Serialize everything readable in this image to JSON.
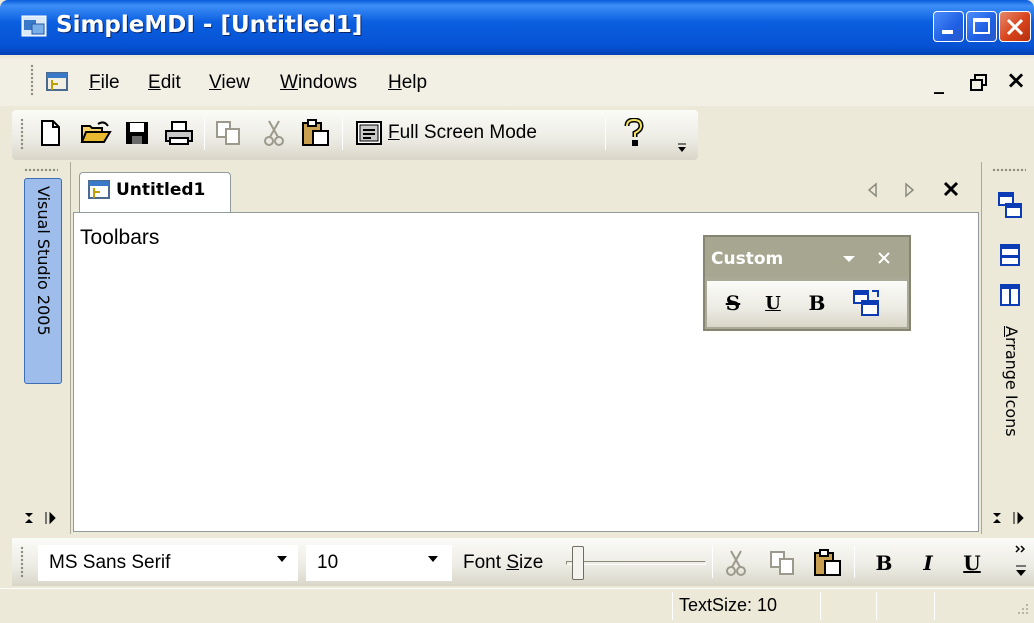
{
  "window": {
    "title": "SimpleMDI - [Untitled1]"
  },
  "menubar": {
    "items": [
      {
        "label": "File",
        "mnemonic": "F",
        "rest": "ile"
      },
      {
        "label": "Edit",
        "mnemonic": "E",
        "rest": "dit"
      },
      {
        "label": "View",
        "mnemonic": "V",
        "rest": "iew"
      },
      {
        "label": "Windows",
        "mnemonic": "W",
        "rest": "indows"
      },
      {
        "label": "Help",
        "mnemonic": "H",
        "rest": "elp"
      }
    ],
    "mdi_minimize": "_",
    "mdi_restore": "🗗",
    "mdi_close": "×"
  },
  "toolbar": {
    "buttons": [
      "new-icon",
      "open-icon",
      "save-icon",
      "print-icon",
      "copy-icon",
      "cut-icon",
      "paste-icon",
      "full-screen-icon",
      "help-icon"
    ],
    "fullscreen": {
      "mnemonic": "F",
      "rest": "ull Screen Mode"
    }
  },
  "left_dock": {
    "tab_label": "Visual Studio 2005"
  },
  "document": {
    "tab_label": "Untitled1",
    "text": "Toolbars"
  },
  "custom_toolbar": {
    "title": "Custom",
    "buttons": [
      {
        "name": "strikethrough-button",
        "glyph": "S"
      },
      {
        "name": "underline-button",
        "glyph": "U"
      },
      {
        "name": "bold-button",
        "glyph": "B"
      },
      {
        "name": "window-icon-button",
        "glyph": ""
      }
    ]
  },
  "right_dock": {
    "label": "Arrange Icons",
    "mnemonic": "A",
    "rest": "rrange Icons"
  },
  "format_bar": {
    "font_name": "MS Sans Serif",
    "font_size": "10",
    "font_size_label_pre": "Font ",
    "font_size_label_mn": "S",
    "font_size_label_post": "ize",
    "bold": "B",
    "italic": "I",
    "underline": "U"
  },
  "statusbar": {
    "text": "TextSize: 10"
  },
  "colors": {
    "title_blue": "#0652d3",
    "tab_blue": "#9ebdea",
    "close_red": "#d8431c"
  }
}
